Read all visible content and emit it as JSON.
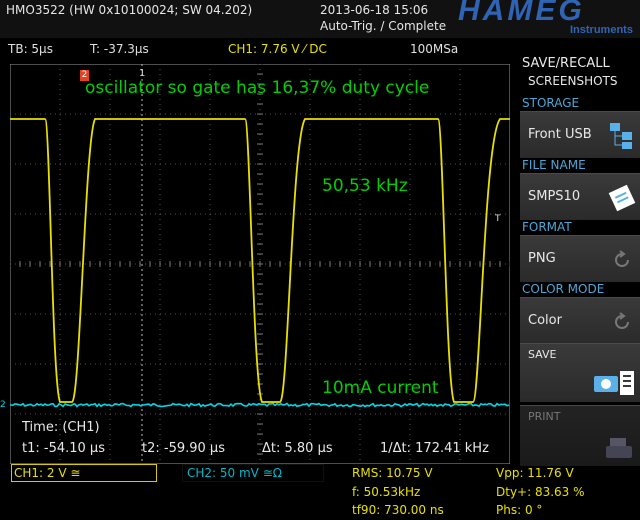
{
  "header": {
    "device_id": "HMO3522 (HW 0x10100024; SW 04.202)",
    "datetime": "2013-06-18 15:06",
    "trigger_status": "Auto-Trig. / Complete",
    "brand": "HAMEG",
    "brand_sub": "Instruments"
  },
  "infobar": {
    "timebase": "TB: 5µs",
    "trig_time": "T: -37.3µs",
    "ch1_trigger": "CH1: 7.76 V ⁄ DC",
    "sample_rate": "100MSa"
  },
  "screen": {
    "annotation_title": "oscillator so gate has 16,37% duty cycle",
    "annotation_freq": "50,53 kHz",
    "annotation_current": "10mA current",
    "trigger_marker": "2",
    "cursor_marker": "1",
    "right_marker": "T",
    "left_marker": "2",
    "cursor_title": "Time: (CH1)",
    "t1": "t1: -54.10 µs",
    "t2": "t2: -59.90 µs",
    "dt": "Δt: 5.80 µs",
    "inv_dt": "1/Δt: 172.41 kHz"
  },
  "sidebar": {
    "title_line1": "SAVE/RECALL",
    "title_line2": "SCREENSHOTS",
    "storage_head": "STORAGE",
    "storage_value": "Front USB",
    "filename_head": "FILE NAME",
    "filename_value": "SMPS10",
    "format_head": "FORMAT",
    "format_value": "PNG",
    "colormode_head": "COLOR MODE",
    "colormode_value": "Color",
    "save_label": "SAVE",
    "print_label": "PRINT"
  },
  "bottom": {
    "ch1": "CH1: 2 V ≅",
    "ch2": "CH2: 50 mV ≅Ω",
    "rms": "RMS: 10.75 V",
    "freq": "f: 50.53kHz",
    "tf90": "tf90: 730.00 ns",
    "vpp": "Vpp: 11.76 V",
    "dty": "Dty+: 83.63 %",
    "phs": "Phs: 0 °"
  },
  "colors": {
    "ch1": "#e8e000",
    "ch2": "#00d8e8",
    "annotation": "#00d000",
    "accent": "#4ea6d6",
    "marker": "#e84020"
  }
}
